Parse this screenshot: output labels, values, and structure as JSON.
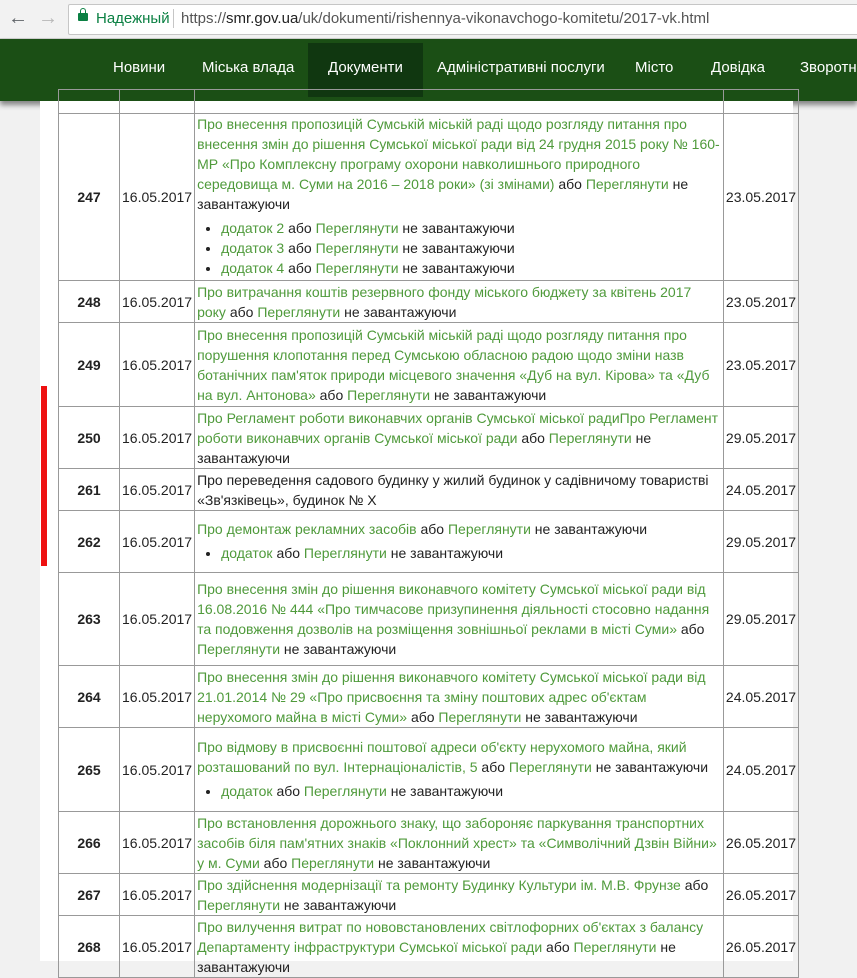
{
  "browser": {
    "secure_label": "Надежный",
    "url_prefix": "https://",
    "url_host": "smr.gov.ua",
    "url_path": "/uk/dokumenti/rishennya-vikonavchogo-komitetu/2017-vk.html"
  },
  "nav": {
    "items": [
      "Новини",
      "Міська влада",
      "Документи",
      "Адміністративні послуги",
      "Місто",
      "Довідка",
      "Зворотні"
    ],
    "active": "Документи"
  },
  "common": {
    "or": "або",
    "view": "Переглянути",
    "not_loading": "не завантажуючи",
    "date": "16.05.2017"
  },
  "rows": [
    {
      "num": "247",
      "title": "Про внесення пропозицій Сумській міській раді щодо розгляду питання про внесення змін до рішення Сумської міської ради від 24 грудня 2015 року № 160-МР «Про Комплексну програму охорони навколишнього природного середовища м. Суми на 2016 – 2018 роки» (зі змінами)",
      "pub": "23.05.2017",
      "attachments": [
        "додаток 2",
        "додаток 3",
        "додаток 4"
      ]
    },
    {
      "num": "248",
      "title": "Про витрачання коштів резервного фонду міського бюджету за квітень 2017 року",
      "pub": "23.05.2017"
    },
    {
      "num": "249",
      "title": "Про внесення пропозицій Сумській міській раді щодо розгляду питання про порушення клопотання перед Сумською обласною радою щодо зміни назв ботанічних пам'яток природи місцевого значення «Дуб на вул. Кірова» та «Дуб на вул. Антонова»",
      "pub": "23.05.2017"
    },
    {
      "num": "250",
      "title": "Про Регламент роботи виконавчих органів Сумської міської радиПро Регламент роботи виконавчих органів Сумської міської ради",
      "pub": "29.05.2017"
    },
    {
      "num": "261",
      "title": "Про переведення садового будинку у жилий будинок у садівничому товаристві «Зв'язківець», будинок № Х",
      "pub": "24.05.2017"
    },
    {
      "num": "262",
      "title": "Про демонтаж рекламних засобів",
      "pub": "29.05.2017",
      "attachments": [
        "додаток"
      ]
    },
    {
      "num": "263",
      "title": "Про внесення змін до рішення виконавчого комітету Сумської міської ради від 16.08.2016 № 444 «Про тимчасове призупинення діяльності стосовно надання та подовження дозволів на розміщення зовнішньої реклами в місті Суми»",
      "pub": "29.05.2017"
    },
    {
      "num": "264",
      "title": "Про внесення змін до рішення виконавчого комітету Сумської міської ради від 21.01.2014 № 29 «Про присвоєння та зміну поштових адрес об'єктам нерухомого майна в місті Суми»",
      "pub": "24.05.2017"
    },
    {
      "num": "265",
      "title": "Про відмову в присвоєнні поштової адреси об'єкту нерухомого майна, який розташований по вул. Інтернаціоналістів, 5",
      "pub": "24.05.2017",
      "attachments": [
        "додаток"
      ]
    },
    {
      "num": "266",
      "title": "Про встановлення дорожнього знаку, що забороняє паркування транспортних засобів біля пам'ятних знаків «Поклонний хрест» та «Символічний Дзвін Війни» у м. Суми",
      "pub": "26.05.2017"
    },
    {
      "num": "267",
      "title": "Про здійснення модернізації та ремонту Будинку Культури ім. М.В. Фрунзе",
      "pub": "26.05.2017"
    },
    {
      "num": "268",
      "title": "Про вилучення витрат по нововстановлених світлофорних об'єктах з балансу Департаменту інфраструктури Сумської міської ради",
      "pub": "26.05.2017"
    }
  ]
}
